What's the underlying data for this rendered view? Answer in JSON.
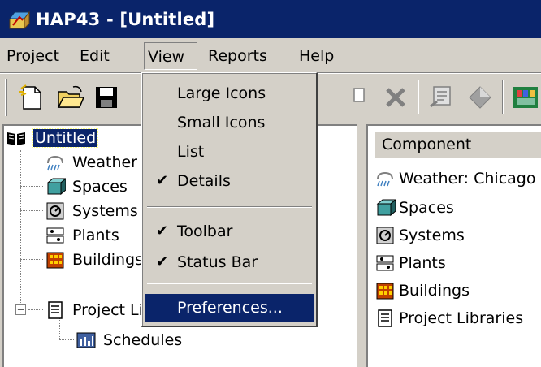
{
  "window": {
    "title": "HAP43 - [Untitled]",
    "app_icon": "hap-app-icon"
  },
  "menubar": {
    "items": [
      "Project",
      "Edit",
      "View",
      "Reports",
      "Help"
    ],
    "open_menu": "View"
  },
  "view_menu": {
    "items": [
      {
        "label": "Large Icons",
        "checked": false
      },
      {
        "label": "Small Icons",
        "checked": false
      },
      {
        "label": "List",
        "checked": false
      },
      {
        "label": "Details",
        "checked": true
      },
      {
        "label": "Toolbar",
        "checked": true
      },
      {
        "label": "Status Bar",
        "checked": true
      },
      {
        "label": "Preferences...",
        "checked": false,
        "highlighted": true
      }
    ],
    "check_glyph": "✔"
  },
  "toolbar": {
    "buttons": [
      "new-document-icon",
      "open-folder-icon",
      "save-disk-icon",
      "copy-icon",
      "delete-icon",
      "properties-icon",
      "diamond-icon",
      "reports-icon"
    ]
  },
  "tree": {
    "root_label": "Untitled",
    "items": [
      "Weather",
      "Spaces",
      "Systems",
      "Plants",
      "Buildings",
      "Project Libraries",
      "Schedules"
    ],
    "expander_symbol": "−"
  },
  "list": {
    "column_header": "Component",
    "rows": [
      "Weather: Chicago",
      "Spaces",
      "Systems",
      "Plants",
      "Buildings",
      "Project Libraries"
    ]
  },
  "colors": {
    "title_bar": "#0a246a",
    "face": "#d4d0c8",
    "highlight": "#0a246a"
  }
}
